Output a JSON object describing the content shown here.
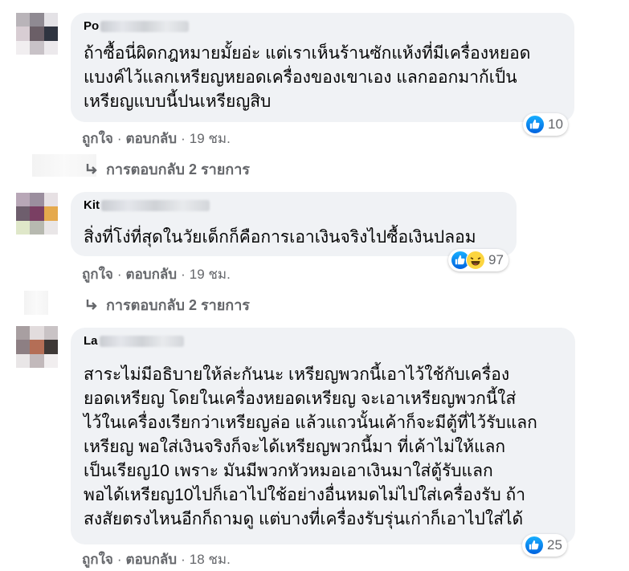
{
  "comments": [
    {
      "author_visible": "Po",
      "text": "ถ้าซื้อนี่ผิดกฎหมายมั้ยอ่ะ แต่เราเห็นร้านซักแห้งที่มีเครื่องหยอด\nแบงค์ไว้แลกเหรียญหยอดเครื่องของเขาเอง แลกออกมาก้เป็น\nเหรียญแบบนี้ปนเหรียญสิบ",
      "reaction_count": "10",
      "like_label": "ถูกใจ",
      "reply_label": "ตอบกลับ",
      "time": "19 ชม.",
      "replies_label": "การตอบกลับ 2 รายการ"
    },
    {
      "author_visible": "Kit",
      "text": "สิ่งที่โง่ที่สุดในวัยเด็กก็คือการเอาเงินจริงไปซื้อเงินปลอม",
      "reaction_count": "97",
      "like_label": "ถูกใจ",
      "reply_label": "ตอบกลับ",
      "time": "19 ชม.",
      "replies_label": "การตอบกลับ 2 รายการ"
    },
    {
      "author_visible": "La",
      "text": "สาระไม่มีอธิบายให้ล่ะกันนะ เหรียญพวกนี้เอาไว้ใช้กับเครื่อง\nยอดเหรียญ โดยในเครื่องหยอดเหรียญ จะเอาเหรียญพวกนี้ใส่\nไว้ในเครื่องเรียกว่าเหรียญล่อ แล้วแถวนั้นเค้าก็จะมีตู้ที่ไว้รับแลก\nเหรียญ พอใส่เงินจริงก็จะได้เหรียญพวกนี้มา ที่เค้าไม่ให้แลก\nเป็นเรียญ10 เพราะ มันมีพวกหัวหมอเอาเงินมาใส่ตู้รับแลก\nพอได้เหรียญ10ไปก็เอาไปใช้อย่างอื่นหมดไม่ไปใส่เครื่องรับ ถ้า\nสงสัยตรงไหนอีกก็ถามดู แต่บางที่เครื่องรับรุ่นเก่าก็เอาไปใส่ได้",
      "reaction_count": "25",
      "like_label": "ถูกใจ",
      "reply_label": "ตอบกลับ",
      "time": "18 ชม."
    }
  ],
  "colors": {
    "bubble": "#f0f2f5",
    "secondary_text": "#65676b",
    "like_blue": "#1877f2",
    "haha_yellow": "#fcd53f"
  },
  "icons": [
    "like-icon",
    "haha-icon",
    "reply-arrow-icon"
  ]
}
